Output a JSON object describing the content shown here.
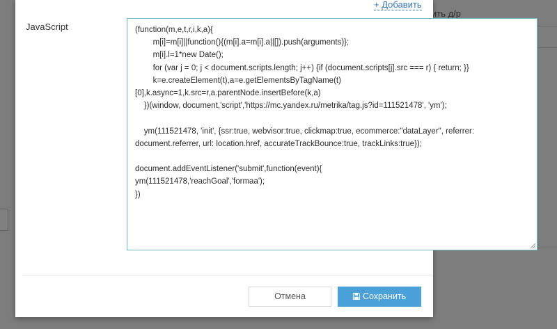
{
  "background": {
    "partial_text": "ить д/р"
  },
  "modal": {
    "add_link": "+ Добавить",
    "field_label": "JavaScript",
    "code": "(function(m,e,t,r,i,k,a){\n        m[i]=m[i]||function(){(m[i].a=m[i].a||[]).push(arguments)};\n        m[i].l=1*new Date();\n        for (var j = 0; j < document.scripts.length; j++) {if (document.scripts[j].src === r) { return; }}\n        k=e.createElement(t),a=e.getElementsByTagName(t)\n[0],k.async=1,k.src=r,a.parentNode.insertBefore(k,a)\n    })(window, document,'script','https://mc.yandex.ru/metrika/tag.js?id=111521478', 'ym');\n\n    ym(111521478, 'init', {ssr:true, webvisor:true, clickmap:true, ecommerce:\"dataLayer\", referrer: document.referrer, url: location.href, accurateTrackBounce:true, trackLinks:true});\n\ndocument.addEventListener('submit',function(event){\nym(111521478,'reachGoal','formaa');\n})",
    "cancel_label": "Отмена",
    "save_label": "Сохранить"
  },
  "colors": {
    "accent": "#4aa0d8",
    "link": "#3a78b6",
    "focus_border": "#6cb7c5"
  },
  "icons": {
    "save": "floppy-disk-icon",
    "resize": "resize-grip-icon"
  }
}
